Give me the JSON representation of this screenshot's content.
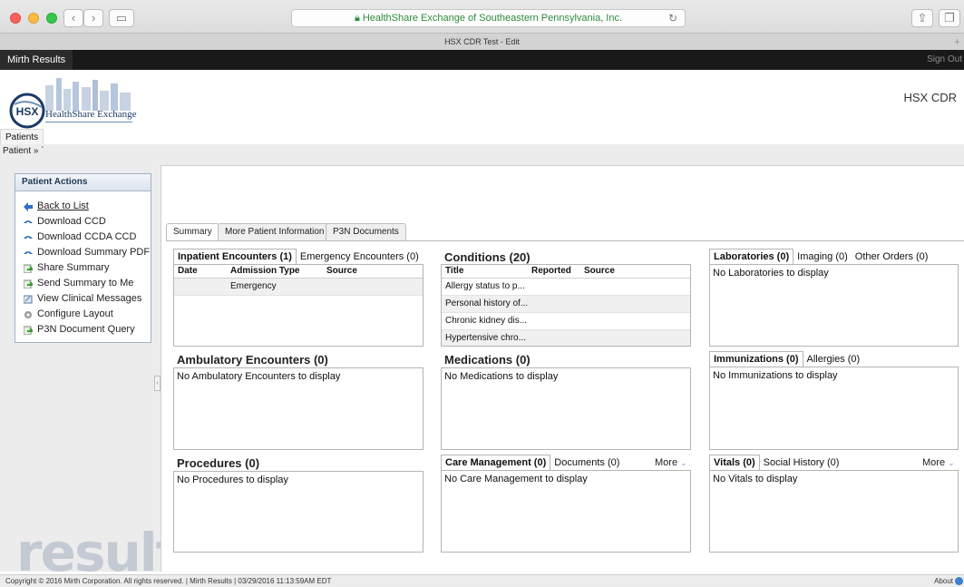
{
  "browser": {
    "url": "HealthShare Exchange of Southeastern Pennsylvania, Inc.",
    "tab_title": "HSX CDR Test - Edit",
    "new_tab": "+"
  },
  "topbar": {
    "brand": "Mirth Results",
    "signout": "Sign Out"
  },
  "header": {
    "logo_text": "HealthShare Exchange",
    "logo_mark": "HSX",
    "app_name": "HSX CDR",
    "tab": "Patients",
    "breadcrumb": "Patient » `"
  },
  "actions": {
    "title": "Patient Actions",
    "items": [
      {
        "label": "Back to List",
        "icon": "back-arrow-icon"
      },
      {
        "label": "Download CCD",
        "icon": "download-icon"
      },
      {
        "label": "Download CCDA CCD",
        "icon": "download-icon"
      },
      {
        "label": "Download Summary PDF",
        "icon": "download-icon"
      },
      {
        "label": "Share Summary",
        "icon": "share-icon"
      },
      {
        "label": "Send Summary to Me",
        "icon": "send-icon"
      },
      {
        "label": "View Clinical Messages",
        "icon": "message-icon"
      },
      {
        "label": "Configure Layout",
        "icon": "gear-icon"
      },
      {
        "label": "P3N Document Query",
        "icon": "query-icon"
      }
    ]
  },
  "content_tabs": [
    "Summary",
    "More Patient Information",
    "P3N Documents"
  ],
  "panels": {
    "encounters": {
      "tab_inpatient": "Inpatient Encounters (1)",
      "tab_emergency": "Emergency Encounters (0)",
      "columns": [
        "Date",
        "Admission Type",
        "Source"
      ],
      "rows": [
        {
          "date": "",
          "type": "Emergency",
          "source": ""
        }
      ]
    },
    "conditions": {
      "title": "Conditions (20)",
      "columns": [
        "Title",
        "Reported",
        "Source"
      ],
      "rows": [
        "Allergy status to p...",
        "Personal history of...",
        "Chronic kidney dis...",
        "Hypertensive chro..."
      ]
    },
    "orders": {
      "tab_lab": "Laboratories (0)",
      "tab_imaging": "Imaging (0)",
      "tab_other": "Other Orders (0)",
      "empty": "No Laboratories to display"
    },
    "ambulatory": {
      "title": "Ambulatory Encounters (0)",
      "empty": "No Ambulatory Encounters to display"
    },
    "medications": {
      "title": "Medications (0)",
      "empty": "No Medications to display"
    },
    "immunizations": {
      "tab_imm": "Immunizations (0)",
      "tab_allergies": "Allergies (0)",
      "empty": "No Immunizations to display"
    },
    "procedures": {
      "title": "Procedures (0)",
      "empty": "No Procedures to display"
    },
    "care": {
      "tab_care": "Care Management (0)",
      "tab_docs": "Documents (0)",
      "more": "More",
      "empty": "No Care Management to display"
    },
    "vitals": {
      "tab_vitals": "Vitals (0)",
      "tab_social": "Social History (0)",
      "more": "More",
      "empty": "No Vitals to display"
    }
  },
  "watermark": "results",
  "footer": {
    "copyright": "Copyright © 2016 Mirth Corporation. All rights reserved. | Mirth Results | 03/29/2016 11:13:59AM EDT",
    "about": "About"
  }
}
